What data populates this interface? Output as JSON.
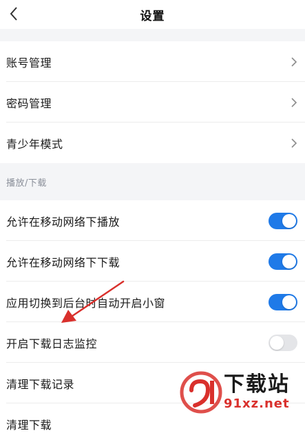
{
  "header": {
    "title": "设置",
    "back_icon": "chevron-left-icon"
  },
  "account_items": [
    {
      "label": "账号管理",
      "icon": "chevron-right-icon"
    },
    {
      "label": "密码管理",
      "icon": "chevron-right-icon"
    },
    {
      "label": "青少年模式",
      "icon": "chevron-right-icon"
    }
  ],
  "section": {
    "label": "播放/下载"
  },
  "toggles": [
    {
      "label": "允许在移动网络下播放",
      "state": "on"
    },
    {
      "label": "允许在移动网络下下载",
      "state": "on"
    },
    {
      "label": "应用切换到后台时自动开启小窗",
      "state": "on"
    },
    {
      "label": "开启下载日志监控",
      "state": "off"
    }
  ],
  "more_items": [
    {
      "label": "清理下载记录"
    },
    {
      "label": "清理下载"
    }
  ],
  "colors": {
    "accent": "#1f7ae8",
    "annotation_arrow": "#d9302c",
    "section_bg": "#f4f5f7"
  },
  "watermark": {
    "title": "下载站",
    "url": "91xz.net"
  }
}
